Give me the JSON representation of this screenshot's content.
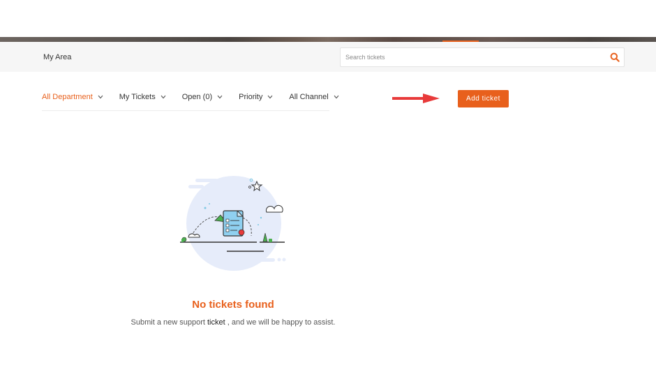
{
  "colors": {
    "accent": "#e8601c",
    "arrow": "#e83a3a",
    "header_bg": "#f6f6f6",
    "illustration_bg": "#e6ecfa",
    "document": "#8fd0f0"
  },
  "header": {
    "title": "My Area",
    "search": {
      "placeholder": "Search tickets",
      "value": "",
      "icon": "search-icon"
    }
  },
  "filters": [
    {
      "label": "All Department",
      "active": true
    },
    {
      "label": "My Tickets",
      "active": false
    },
    {
      "label": "Open (0)",
      "active": false
    },
    {
      "label": "Priority",
      "active": false
    },
    {
      "label": "All Channel",
      "active": false
    }
  ],
  "actions": {
    "add_ticket_label": "Add ticket"
  },
  "empty_state": {
    "title": "No tickets found",
    "sub_before": "Submit a new support ",
    "sub_link": "ticket",
    "sub_after": " , and we will be happy to assist."
  }
}
